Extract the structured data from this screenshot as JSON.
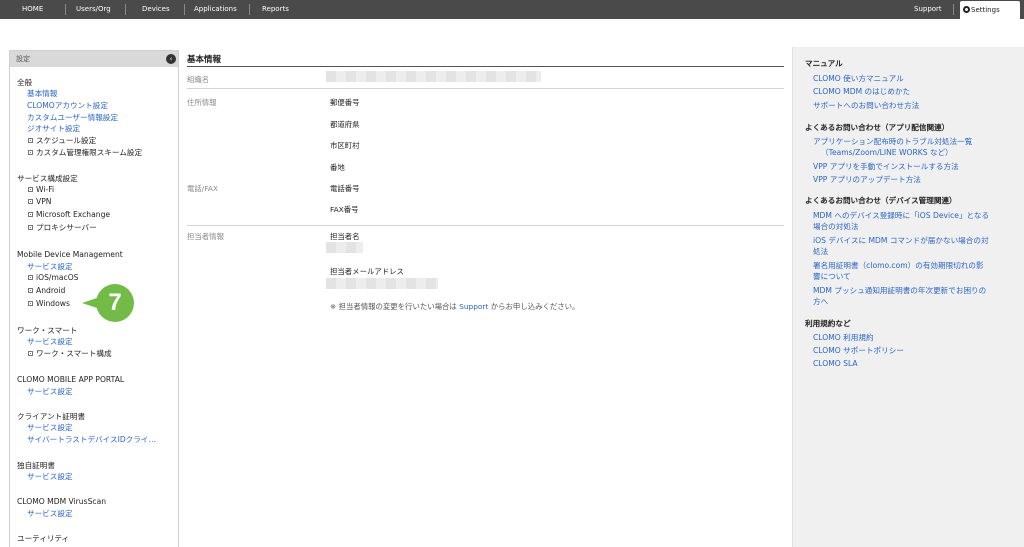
{
  "topnav": {
    "items": [
      "HOME",
      "Users/Org",
      "Devices",
      "Applications",
      "Reports"
    ],
    "support": "Support",
    "settings": "Settings"
  },
  "sidebar": {
    "header": "設定",
    "collapse_icon": "chevron-left-icon",
    "sections": [
      {
        "title": "全般",
        "links": [
          "基本情報",
          "CLOMOアカウント設定",
          "カスタムユーザー情報設定",
          "ジオサイト設定"
        ],
        "expanders": [
          "スケジュール設定",
          "カスタム管理権限スキーム設定"
        ]
      },
      {
        "title": "サービス構成設定",
        "links": [],
        "expanders": [
          "Wi-Fi",
          "VPN",
          "Microsoft Exchange",
          "プロキシサーバー"
        ]
      },
      {
        "title": "Mobile Device Management",
        "links": [
          "サービス設定"
        ],
        "expanders": [
          "iOS/macOS",
          "Android",
          "Windows"
        ]
      },
      {
        "title": "ワーク・スマート",
        "links": [
          "サービス設定"
        ],
        "expanders": [
          "ワーク・スマート構成"
        ]
      },
      {
        "title": "CLOMO MOBILE APP PORTAL",
        "links": [
          "サービス設定"
        ],
        "expanders": []
      },
      {
        "title": "クライアント証明書",
        "links": [
          "サービス設定",
          "サイバートラストデバイスIDクライ…"
        ],
        "expanders": []
      },
      {
        "title": "独自証明書",
        "links": [
          "サービス設定"
        ],
        "expanders": []
      },
      {
        "title": "CLOMO MDM VirusScan",
        "links": [
          "サービス設定"
        ],
        "expanders": []
      },
      {
        "title": "ユーティリティ",
        "links": [],
        "expanders": []
      }
    ],
    "step_badge": "7"
  },
  "main": {
    "title": "基本情報",
    "org_label": "組織名",
    "address_label": "住所情報",
    "address_fields": [
      "郵便番号",
      "都道府県",
      "市区町村",
      "番地"
    ],
    "phone_label": "電話/FAX",
    "phone_fields": [
      "電話番号",
      "FAX番号"
    ],
    "contact_label": "担当者情報",
    "contact_fields": [
      "担当者名",
      "担当者メールアドレス"
    ],
    "note_prefix": "※ 担当者情報の変更を行いたい場合は ",
    "note_link": "Support",
    "note_suffix": " からお申し込みください。"
  },
  "right_panel": {
    "manual_title": "マニュアル",
    "manual_links": [
      "CLOMO 使い方マニュアル",
      "CLOMO MDM のはじめかた",
      "サポートへのお問い合わせ方法"
    ],
    "faq_app_title": "よくあるお問い合わせ（アプリ配信関連）",
    "faq_app_links": [
      "アプリケーション配布時のトラブル対処法一覧",
      "（Teams/Zoom/LINE WORKS など）",
      "VPP アプリを手動でインストールする方法",
      "VPP アプリのアップデート方法"
    ],
    "faq_device_title": "よくあるお問い合わせ（デバイス管理関連）",
    "faq_device_links": [
      "MDM へのデバイス登録時に「iOS Device」となる",
      "場合の対処法",
      "iOS デバイスに MDM コマンドが届かない場合の対",
      "処法",
      "署名用証明書（clomo.com）の有効期限切れの影",
      "響について",
      "MDM プッシュ通知用証明書の年次更新でお困りの",
      "方へ"
    ],
    "terms_title": "利用規約など",
    "terms_links": [
      "CLOMO 利用規約",
      "CLOMO サポートポリシー",
      "CLOMO SLA"
    ]
  },
  "colors": {
    "nav_bg": "#4a4a4a",
    "link": "#2a64c9",
    "badge": "#72bb47",
    "panel_bg": "#f0f0f0"
  }
}
